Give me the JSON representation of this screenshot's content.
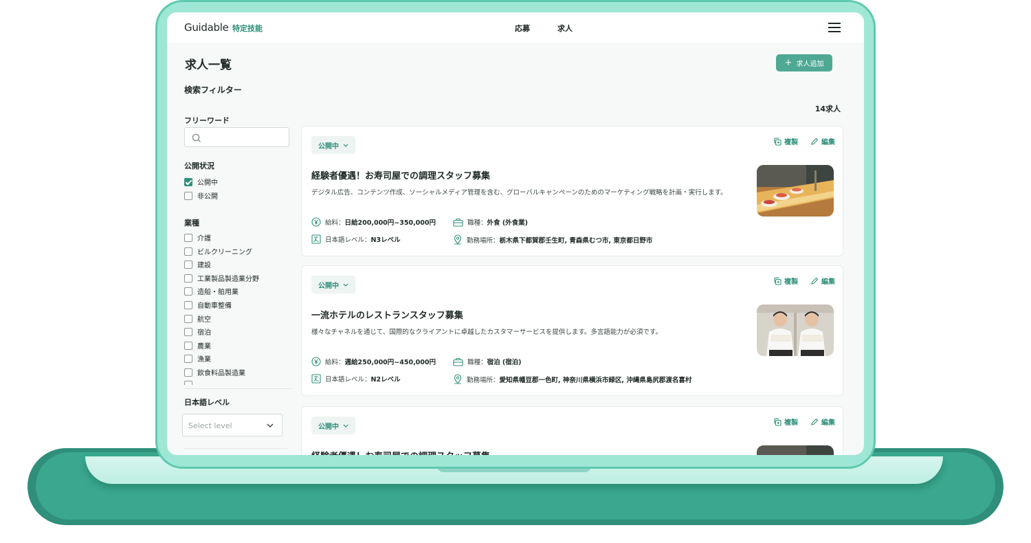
{
  "header": {
    "logo": "Guidable",
    "logo_sub": "特定技能",
    "nav": [
      "応募",
      "求人"
    ]
  },
  "page": {
    "title": "求人一覧",
    "add_button": "求人追加",
    "result_count": "14求人"
  },
  "filters": {
    "title": "検索フィルター",
    "freeword_label": "フリーワード",
    "freeword_value": "",
    "status_label": "公開状況",
    "status_options": [
      {
        "label": "公開中",
        "checked": true
      },
      {
        "label": "非公開",
        "checked": false
      }
    ],
    "industry_label": "業種",
    "industries": [
      "介護",
      "ビルクリーニング",
      "建設",
      "工業製品製造業分野",
      "造船・舶用業",
      "自動車整備",
      "航空",
      "宿泊",
      "農業",
      "漁業",
      "飲食料品製造業"
    ],
    "japanese_label": "日本語レベル",
    "japanese_placeholder": "Select level"
  },
  "jobs": [
    {
      "status": "公開中",
      "copy": "複製",
      "edit": "編集",
      "title": "経験者優遇！お寿司屋での調理スタッフ募集",
      "description": "デジタル広告、コンテンツ作成、ソーシャルメディア管理を含む、グローバルキャンペーンのためのマーケティング戦略を計画・実行します。",
      "salary_label": "給料：",
      "salary": "日給200,000円~350,000円",
      "jobtype_label": "職種：",
      "jobtype": "外食 (外食業)",
      "jp_label": "日本語レベル：",
      "jp_level": "N3レベル",
      "location_label": "勤務場所：",
      "location": "栃木県下都賀郡壬生町, 青森県むつ市, 東京都日野市",
      "image": "sushi-photo"
    },
    {
      "status": "公開中",
      "copy": "複製",
      "edit": "編集",
      "title": "一流ホテルのレストランスタッフ募集",
      "description": "様々なチャネルを通じて、国際的なクライアントに卓越したカスタマーサービスを提供します。多言語能力が必須です。",
      "salary_label": "給料：",
      "salary": "週給250,000円~450,000円",
      "jobtype_label": "職種：",
      "jobtype": "宿泊 (宿泊)",
      "jp_label": "日本語レベル：",
      "jp_level": "N2レベル",
      "location_label": "勤務場所：",
      "location": "愛知県幡豆郡一色町, 神奈川県横浜市緑区, 沖縄県島尻郡渡名喜村",
      "image": "hotel-staff-photo"
    },
    {
      "status": "公開中",
      "copy": "複製",
      "edit": "編集",
      "title": "経験者優遇！お寿司屋での調理スタッフ募集",
      "image": "sushi-photo"
    }
  ],
  "colors": {
    "accent": "#2f8f7a",
    "button": "#4fa893",
    "device": "#9fe7d5"
  },
  "icons": [
    "search-icon",
    "check-icon",
    "chevron-down-icon",
    "plus-icon",
    "copy-icon",
    "pencil-icon",
    "yen-icon",
    "briefcase-icon",
    "language-icon",
    "location-pin-icon",
    "hamburger-icon"
  ]
}
